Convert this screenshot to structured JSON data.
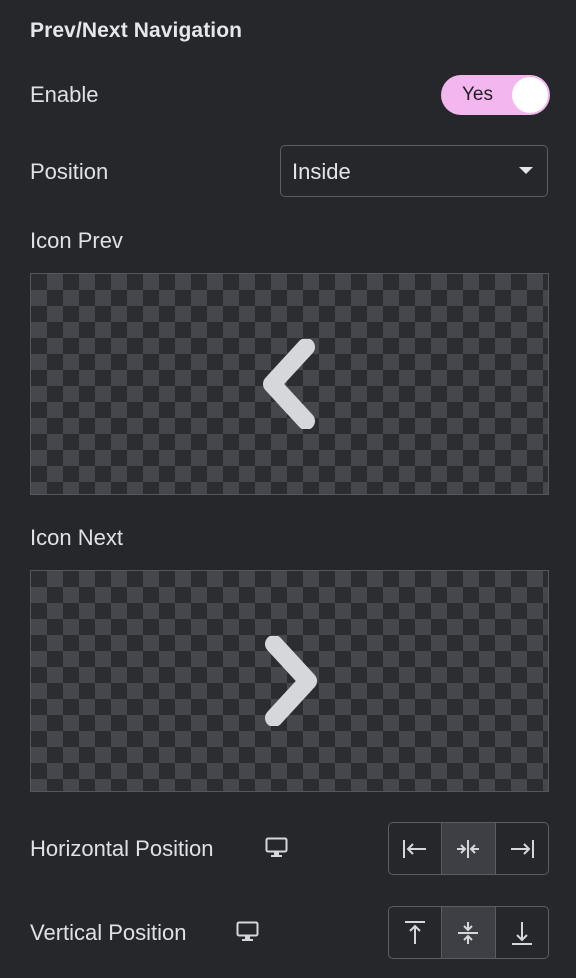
{
  "section": {
    "title": "Prev/Next Navigation"
  },
  "enable": {
    "label": "Enable",
    "toggle_label": "Yes",
    "checked": true
  },
  "position": {
    "label": "Position",
    "selected": "Inside"
  },
  "icon_prev": {
    "label": "Icon Prev",
    "icon": "chevron-left-icon"
  },
  "icon_next": {
    "label": "Icon Next",
    "icon": "chevron-right-icon"
  },
  "horizontal_position": {
    "label": "Horizontal Position",
    "device_icon": "desktop-icon",
    "options": [
      "align-left-icon",
      "align-center-icon",
      "align-right-icon"
    ],
    "active_index": 1
  },
  "vertical_position": {
    "label": "Vertical Position",
    "device_icon": "desktop-icon",
    "options": [
      "align-top-icon",
      "align-middle-icon",
      "align-bottom-icon"
    ],
    "active_index": 1
  },
  "colors": {
    "background": "#26272b",
    "toggle_on": "#f3b6ef",
    "text": "#e0e1e4",
    "border": "#5b5d63"
  }
}
